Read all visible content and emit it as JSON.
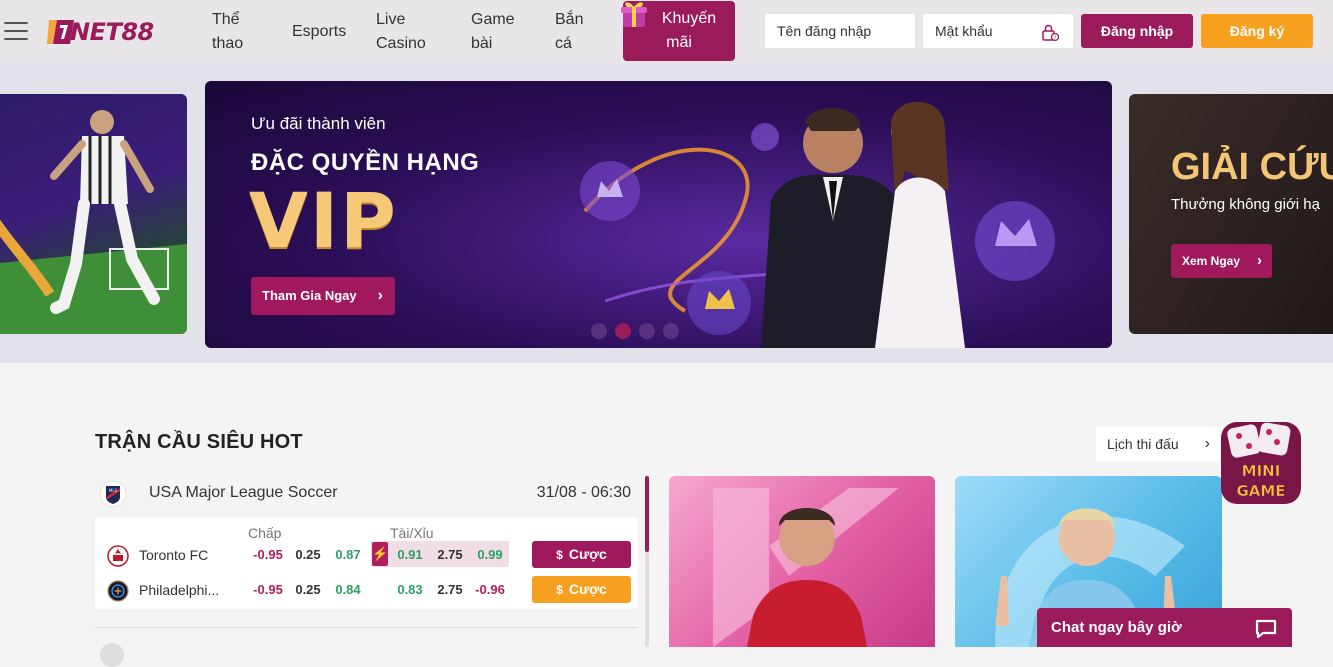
{
  "header": {
    "logo_text": "NET88",
    "nav": [
      {
        "label": "Thể\nthao"
      },
      {
        "label": "Esports"
      },
      {
        "label": "Live\nCasino"
      },
      {
        "label": "Game\nbài"
      },
      {
        "label": "Bắn\ncá"
      }
    ],
    "promo_label": "Khuyến\nmãi",
    "username_placeholder": "Tên đăng nhập",
    "password_placeholder": "Mật khẩu",
    "login_label": "Đăng nhập",
    "register_label": "Đăng ký"
  },
  "banner": {
    "main": {
      "subtitle": "Ưu đãi thành viên",
      "title": "ĐẶC QUYỀN HẠNG",
      "highlight": "VIP",
      "cta": "Tham Gia Ngay"
    },
    "right": {
      "title": "GIẢI CỨU",
      "subtitle": "Thưởng không giới hạ",
      "cta": "Xem Ngay"
    },
    "dots": 4,
    "active_dot": 2
  },
  "section": {
    "title": "TRẬN CẦU SIÊU HOT",
    "schedule_label": "Lịch thi đấu",
    "league": {
      "name": "USA Major League Soccer",
      "datetime": "31/08 - 06:30"
    },
    "handicap_label": "Chấp",
    "overunder_label": "Tài/Xỉu",
    "teams": [
      {
        "name": "Toronto FC",
        "handicap": [
          "-0.95",
          "0.25",
          "0.87"
        ],
        "overunder": [
          "0.91",
          "2.75",
          "0.99"
        ],
        "bet_label": "Cược",
        "bet_style": "red"
      },
      {
        "name": "Philadelphi...",
        "handicap": [
          "-0.95",
          "0.25",
          "0.84"
        ],
        "overunder": [
          "0.83",
          "2.75",
          "-0.96"
        ],
        "bet_label": "Cược",
        "bet_style": "orange"
      }
    ]
  },
  "minigame_label": "MINI GAME",
  "chat_label": "Chat ngay bây giờ",
  "colors": {
    "brand": "#9b1b5a",
    "accent": "#f7a01f",
    "positive": "#2ea06a"
  }
}
